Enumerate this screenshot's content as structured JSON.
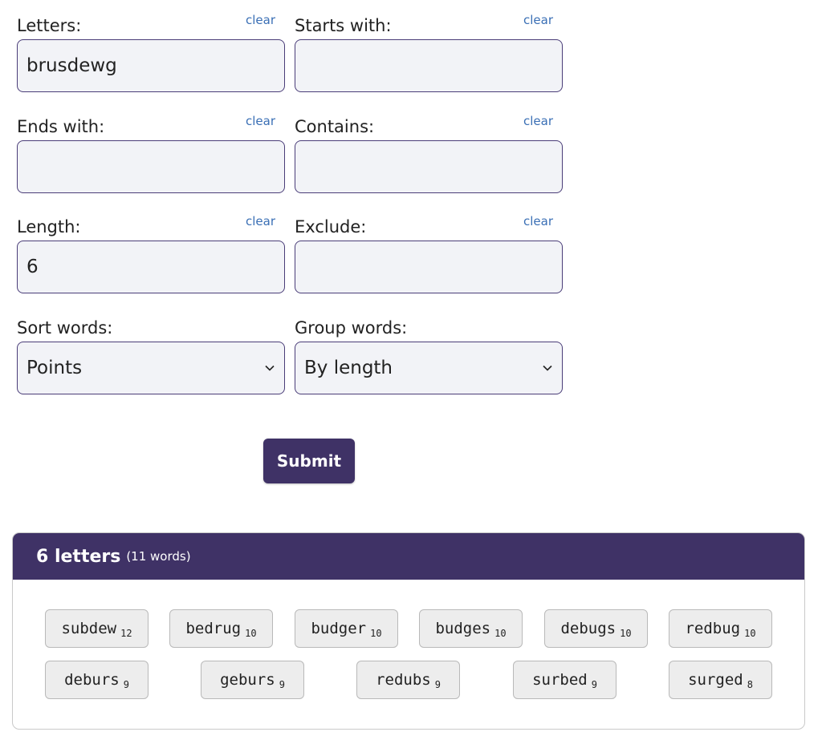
{
  "form": {
    "clear_label": "clear",
    "letters": {
      "label": "Letters:",
      "value": "brusdewg"
    },
    "starts_with": {
      "label": "Starts with:",
      "value": ""
    },
    "ends_with": {
      "label": "Ends with:",
      "value": ""
    },
    "contains": {
      "label": "Contains:",
      "value": ""
    },
    "length": {
      "label": "Length:",
      "value": "6"
    },
    "exclude": {
      "label": "Exclude:",
      "value": ""
    },
    "sort": {
      "label": "Sort words:",
      "value": "Points"
    },
    "group": {
      "label": "Group words:",
      "value": "By length"
    },
    "submit_label": "Submit"
  },
  "results": {
    "header_title": "6 letters",
    "header_count": "(11 words)",
    "words": [
      {
        "word": "subdew",
        "points": "12"
      },
      {
        "word": "bedrug",
        "points": "10"
      },
      {
        "word": "budger",
        "points": "10"
      },
      {
        "word": "budges",
        "points": "10"
      },
      {
        "word": "debugs",
        "points": "10"
      },
      {
        "word": "redbug",
        "points": "10"
      },
      {
        "word": "deburs",
        "points": "9"
      },
      {
        "word": "geburs",
        "points": "9"
      },
      {
        "word": "redubs",
        "points": "9"
      },
      {
        "word": "surbed",
        "points": "9"
      },
      {
        "word": "surged",
        "points": "8"
      }
    ]
  }
}
